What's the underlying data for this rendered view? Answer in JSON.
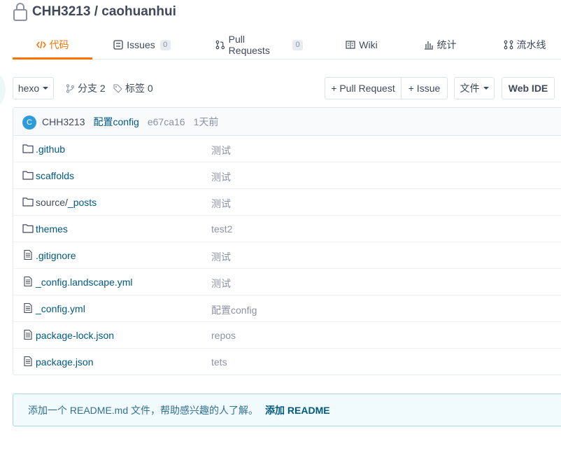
{
  "repo": {
    "owner": "CHH3213",
    "separator": " / ",
    "name": "caohuanhui"
  },
  "tabs": [
    {
      "label": "代码",
      "icon": "code-icon",
      "active": true
    },
    {
      "label": "Issues",
      "icon": "issues-icon",
      "count": "0"
    },
    {
      "label": "Pull Requests",
      "icon": "pull-request-icon",
      "count": "0"
    },
    {
      "label": "Wiki",
      "icon": "wiki-book-icon"
    },
    {
      "label": "统计",
      "icon": "bar-chart-icon"
    },
    {
      "label": "流水线",
      "icon": "pipeline-icon"
    }
  ],
  "toolbar": {
    "branch": "hexo",
    "branches_label": "分支 2",
    "tags_label": "标签 0",
    "pull_request": "+ Pull Request",
    "issue": "+ Issue",
    "file_menu": "文件",
    "web_ide": "Web IDE"
  },
  "commit": {
    "avatar": "C",
    "author": "CHH3213",
    "message": "配置config",
    "sha": "e67ca16",
    "time": "1天前"
  },
  "files": [
    {
      "type": "folder",
      "name": ".github",
      "message": "测试"
    },
    {
      "type": "folder",
      "name": "scaffolds",
      "message": "测试"
    },
    {
      "type": "folder",
      "name_prefix": "source/",
      "name": "_posts",
      "message": "测试"
    },
    {
      "type": "folder",
      "name": "themes",
      "message": "test2"
    },
    {
      "type": "file",
      "name": ".gitignore",
      "message": "测试"
    },
    {
      "type": "file",
      "name": "_config.landscape.yml",
      "message": "测试"
    },
    {
      "type": "file",
      "name": "_config.yml",
      "message": "配置config"
    },
    {
      "type": "file",
      "name": "package-lock.json",
      "message": "repos"
    },
    {
      "type": "file",
      "name": "package.json",
      "message": "tets"
    }
  ],
  "readme": {
    "prompt": "添加一个 README.md 文件，帮助感兴趣的人了解。",
    "link": "添加 README"
  },
  "colors": {
    "accent": "#fe7300",
    "link": "#005980",
    "muted": "#8c92a4",
    "text": "#40485b"
  }
}
